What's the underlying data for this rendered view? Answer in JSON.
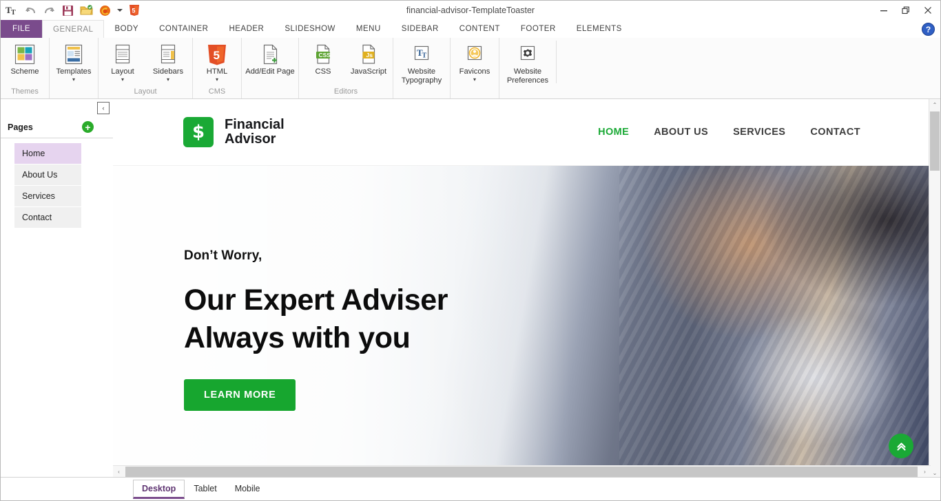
{
  "window": {
    "title": "financial-advisor-TemplateToaster",
    "controls": {
      "minimize": "minimize-icon",
      "maximize": "maximize-icon",
      "close": "close-icon"
    },
    "help_label": "?"
  },
  "quick_access": [
    {
      "name": "typography-icon",
      "label": "Tᴛ"
    },
    {
      "name": "undo-icon",
      "label": "↶"
    },
    {
      "name": "redo-icon",
      "label": "↷"
    },
    {
      "name": "save-icon",
      "label": "save"
    },
    {
      "name": "open-folder-icon",
      "label": "open"
    },
    {
      "name": "preview-firefox-icon",
      "label": "preview"
    },
    {
      "name": "preview-dropdown-caret",
      "label": "▾"
    },
    {
      "name": "html5-export-icon",
      "label": "5"
    }
  ],
  "ribbon": {
    "file_tab": "FILE",
    "tabs": [
      {
        "label": "GENERAL",
        "active": true
      },
      {
        "label": "BODY",
        "active": false
      },
      {
        "label": "CONTAINER",
        "active": false
      },
      {
        "label": "HEADER",
        "active": false
      },
      {
        "label": "SLIDESHOW",
        "active": false
      },
      {
        "label": "MENU",
        "active": false
      },
      {
        "label": "SIDEBAR",
        "active": false
      },
      {
        "label": "CONTENT",
        "active": false
      },
      {
        "label": "FOOTER",
        "active": false
      },
      {
        "label": "ELEMENTS",
        "active": false
      }
    ],
    "groups": [
      {
        "label": "Themes",
        "buttons": [
          {
            "label": "Scheme",
            "icon": "color-scheme-icon",
            "caret": ""
          }
        ]
      },
      {
        "label": "",
        "buttons": [
          {
            "label": "Templates",
            "icon": "templates-icon",
            "caret": "▾"
          }
        ]
      },
      {
        "label": "Layout",
        "buttons": [
          {
            "label": "Layout",
            "icon": "layout-icon",
            "caret": "▾"
          },
          {
            "label": "Sidebars",
            "icon": "sidebars-icon",
            "caret": "▾"
          }
        ]
      },
      {
        "label": "CMS",
        "buttons": [
          {
            "label": "HTML",
            "icon": "html5-icon",
            "caret": "▾"
          }
        ]
      },
      {
        "label": "",
        "buttons": [
          {
            "label": "Add/Edit Page",
            "icon": "add-edit-page-icon",
            "caret": ""
          }
        ]
      },
      {
        "label": "Editors",
        "buttons": [
          {
            "label": "CSS",
            "icon": "css-file-icon",
            "caret": ""
          },
          {
            "label": "JavaScript",
            "icon": "js-file-icon",
            "caret": ""
          }
        ]
      },
      {
        "label": "",
        "buttons": [
          {
            "label": "Website Typography",
            "icon": "website-typography-icon",
            "caret": ""
          }
        ]
      },
      {
        "label": "",
        "buttons": [
          {
            "label": "Favicons",
            "icon": "favicons-icon",
            "caret": "▾"
          }
        ]
      },
      {
        "label": "",
        "buttons": [
          {
            "label": "Website Preferences",
            "icon": "website-preferences-icon",
            "caret": ""
          }
        ]
      }
    ]
  },
  "pages_panel": {
    "title": "Pages",
    "add_label": "+",
    "collapse_label": "‹",
    "items": [
      {
        "label": "Home",
        "active": true
      },
      {
        "label": "About Us",
        "active": false
      },
      {
        "label": "Services",
        "active": false
      },
      {
        "label": "Contact",
        "active": false
      }
    ]
  },
  "preview": {
    "site": {
      "brand": {
        "badge": "$",
        "line1": "Financial",
        "line2": "Advisor"
      },
      "nav": [
        {
          "label": "HOME",
          "active": true
        },
        {
          "label": "ABOUT US",
          "active": false
        },
        {
          "label": "SERVICES",
          "active": false
        },
        {
          "label": "CONTACT",
          "active": false
        }
      ],
      "hero": {
        "kicker": "Don’t Worry,",
        "title_line1": "Our Expert Adviser",
        "title_line2": "Always with you",
        "cta": "LEARN MORE",
        "scroll_top_icon": "double-chevron-up-icon"
      }
    },
    "scrollbars": {
      "v_up": "⌃",
      "v_down": "⌄",
      "h_left": "‹",
      "h_right": "›"
    }
  },
  "device_tabs": [
    {
      "label": "Desktop",
      "active": true
    },
    {
      "label": "Tablet",
      "active": false
    },
    {
      "label": "Mobile",
      "active": false
    }
  ],
  "colors": {
    "accent_purple": "#7a4b8c",
    "brand_green": "#1aa935",
    "cta_green": "#17a62f",
    "active_page": "#e6d4ef"
  }
}
